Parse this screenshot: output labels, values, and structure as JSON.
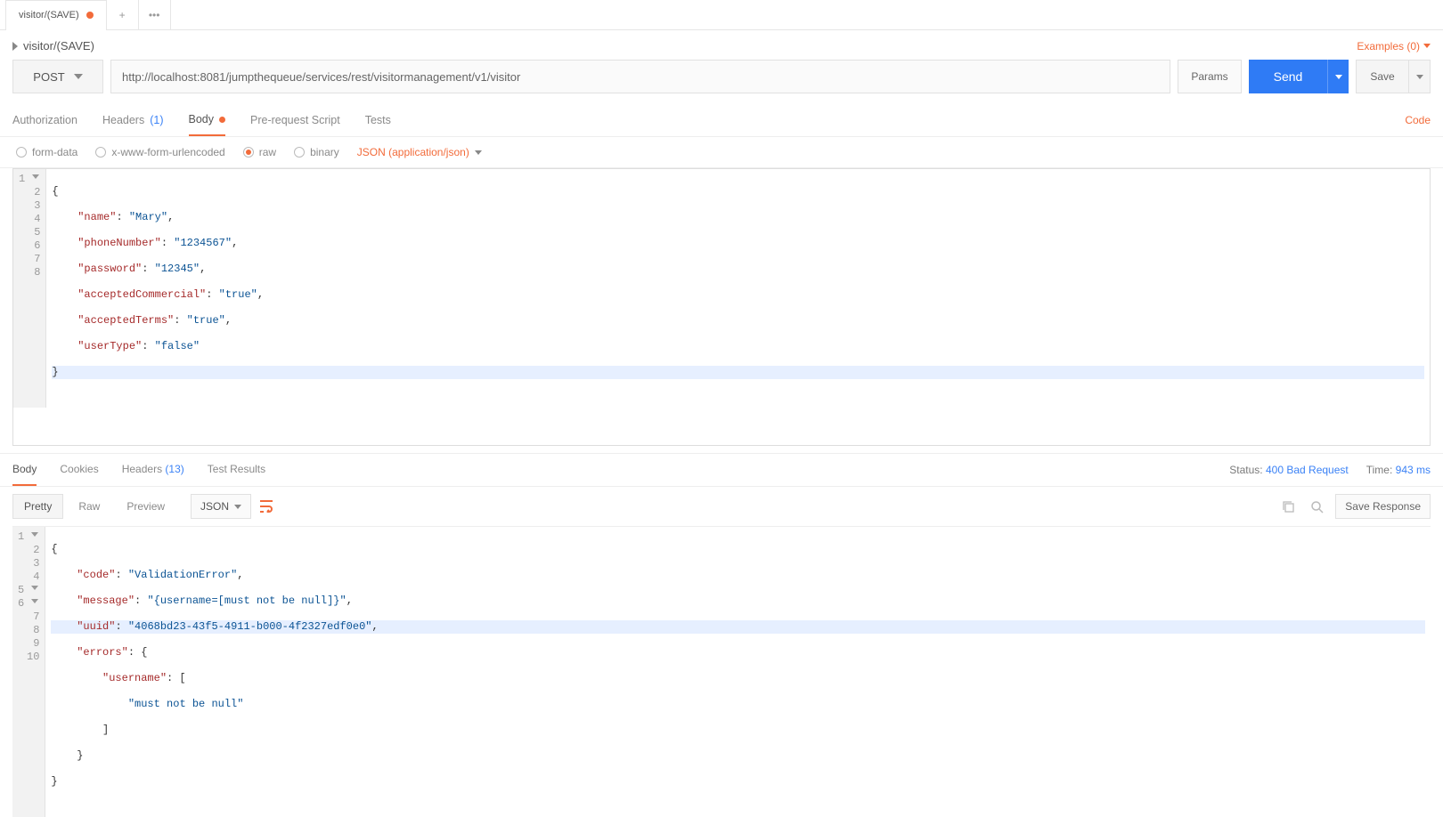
{
  "tab": {
    "title": "visitor/(SAVE)"
  },
  "title": "visitor/(SAVE)",
  "examples": {
    "label": "Examples (0)"
  },
  "request": {
    "method": "POST",
    "url": "http://localhost:8081/jumpthequeue/services/rest/visitormanagement/v1/visitor",
    "params_btn": "Params",
    "send_btn": "Send",
    "save_btn": "Save"
  },
  "req_tabs": {
    "authorization": "Authorization",
    "headers_label": "Headers",
    "headers_count": "(1)",
    "body": "Body",
    "prerequest": "Pre-request Script",
    "tests": "Tests",
    "code_link": "Code"
  },
  "body_types": {
    "form_data": "form-data",
    "urlencoded": "x-www-form-urlencoded",
    "raw": "raw",
    "binary": "binary",
    "content_type": "JSON (application/json)"
  },
  "request_body": {
    "lines": [
      "1",
      "2",
      "3",
      "4",
      "5",
      "6",
      "7",
      "8"
    ],
    "l1": "{",
    "l2_key": "\"name\"",
    "l2_val": "\"Mary\"",
    "l3_key": "\"phoneNumber\"",
    "l3_val": "\"1234567\"",
    "l4_key": "\"password\"",
    "l4_val": "\"12345\"",
    "l5_key": "\"acceptedCommercial\"",
    "l5_val": "\"true\"",
    "l6_key": "\"acceptedTerms\"",
    "l6_val": "\"true\"",
    "l7_key": "\"userType\"",
    "l7_val": "\"false\"",
    "l8": "}"
  },
  "response_tabs": {
    "body": "Body",
    "cookies": "Cookies",
    "headers_label": "Headers",
    "headers_count": "(13)",
    "test_results": "Test Results"
  },
  "response_meta": {
    "status_label": "Status:",
    "status_value": "400 Bad Request",
    "time_label": "Time:",
    "time_value": "943 ms"
  },
  "response_toolbar": {
    "pretty": "Pretty",
    "raw": "Raw",
    "preview": "Preview",
    "format": "JSON",
    "save_response": "Save Response"
  },
  "response_body": {
    "lines": [
      "1",
      "2",
      "3",
      "4",
      "5",
      "6",
      "7",
      "8",
      "9",
      "10"
    ],
    "r1": "{",
    "r2_key": "\"code\"",
    "r2_val": "\"ValidationError\"",
    "r3_key": "\"message\"",
    "r3_val": "\"{username=[must not be null]}\"",
    "r4_key": "\"uuid\"",
    "r4_val": "\"4068bd23-43f5-4911-b000-4f2327edf0e0\"",
    "r5_key": "\"errors\"",
    "r6_key": "\"username\"",
    "r7_val": "\"must not be null\"",
    "r8": "]",
    "r9": "}",
    "r10": "}"
  }
}
